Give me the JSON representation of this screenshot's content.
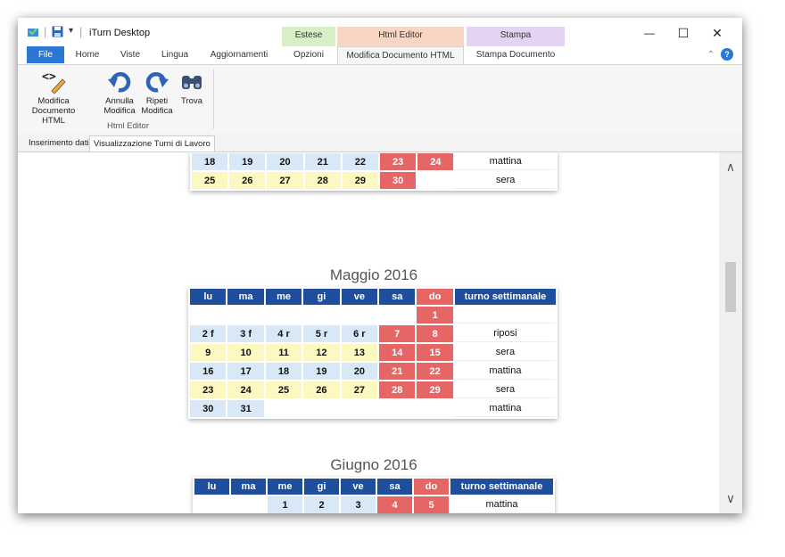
{
  "app": {
    "title": "iTurn Desktop",
    "quick_access_sep": "|",
    "quick_access_dropdown": "▾"
  },
  "context_groups": [
    {
      "label": "Estese",
      "color": "#d6efc5"
    },
    {
      "label": "Html Editor",
      "color": "#f9d6c3"
    },
    {
      "label": "Stampa",
      "color": "#e4d3f3"
    }
  ],
  "tabs": {
    "file": "File",
    "home": "Home",
    "viste": "Viste",
    "lingua": "Lingua",
    "aggiornamenti": "Aggiornamenti",
    "opzioni": "Opzioni",
    "modifica_html": "Modifica Documento HTML",
    "stampa_documento": "Stampa Documento"
  },
  "ribbon": {
    "buttons": [
      {
        "label": "Modifica Documento HTML",
        "icon": "code-edit-icon"
      },
      {
        "label": "Annulla Modifica",
        "icon": "undo-icon"
      },
      {
        "label": "Ripeti Modifica",
        "icon": "redo-icon"
      },
      {
        "label": "Trova",
        "icon": "binoculars-icon"
      }
    ],
    "group_label": "Html Editor"
  },
  "doc_tabs": [
    "Inserimento dati",
    "Visualizzazione Turni di Lavoro"
  ],
  "calendar": {
    "partial_rows": [
      {
        "days": [
          "18",
          "19",
          "20",
          "21",
          "22",
          "23",
          "24"
        ],
        "turno": "mattina",
        "styles": [
          "b",
          "b",
          "b",
          "b",
          "b",
          "r",
          "r"
        ]
      },
      {
        "days": [
          "25",
          "26",
          "27",
          "28",
          "29",
          "30",
          ""
        ],
        "turno": "sera",
        "styles": [
          "y",
          "y",
          "y",
          "y",
          "y",
          "r",
          "e"
        ]
      }
    ],
    "may": {
      "title": "Maggio 2016",
      "headers": [
        "lu",
        "ma",
        "me",
        "gi",
        "ve",
        "sa",
        "do",
        "turno settimanale"
      ],
      "rows": [
        {
          "days": [
            "",
            "",
            "",
            "",
            "",
            "",
            "1"
          ],
          "turno": "",
          "styles": [
            "e",
            "e",
            "e",
            "e",
            "e",
            "e",
            "r"
          ]
        },
        {
          "days": [
            "2 f",
            "3 f",
            "4 r",
            "5 r",
            "6 r",
            "7",
            "8"
          ],
          "turno": "riposi",
          "styles": [
            "b",
            "b",
            "b",
            "b",
            "b",
            "r",
            "r"
          ]
        },
        {
          "days": [
            "9",
            "10",
            "11",
            "12",
            "13",
            "14",
            "15"
          ],
          "turno": "sera",
          "styles": [
            "y",
            "y",
            "y",
            "y",
            "y",
            "r",
            "r"
          ]
        },
        {
          "days": [
            "16",
            "17",
            "18",
            "19",
            "20",
            "21",
            "22"
          ],
          "turno": "mattina",
          "styles": [
            "b",
            "b",
            "b",
            "b",
            "b",
            "r",
            "r"
          ]
        },
        {
          "days": [
            "23",
            "24",
            "25",
            "26",
            "27",
            "28",
            "29"
          ],
          "turno": "sera",
          "styles": [
            "y",
            "y",
            "y",
            "y",
            "y",
            "r",
            "r"
          ]
        },
        {
          "days": [
            "30",
            "31",
            "",
            "",
            "",
            "",
            ""
          ],
          "turno": "mattina",
          "styles": [
            "b",
            "b",
            "e",
            "e",
            "e",
            "e",
            "e"
          ]
        }
      ]
    },
    "june": {
      "title": "Giugno 2016",
      "headers": [
        "lu",
        "ma",
        "me",
        "gi",
        "ve",
        "sa",
        "do",
        "turno settimanale"
      ],
      "rows": [
        {
          "days": [
            "",
            "",
            "1",
            "2",
            "3",
            "4",
            "5"
          ],
          "turno": "mattina",
          "styles": [
            "e",
            "e",
            "b",
            "b",
            "b",
            "r",
            "r"
          ]
        }
      ]
    }
  },
  "window_controls": {
    "minimize": "—",
    "maximize": "☐",
    "close": "✕"
  },
  "scroll": {
    "up": "∧",
    "down": "∨",
    "position": 0.33
  }
}
